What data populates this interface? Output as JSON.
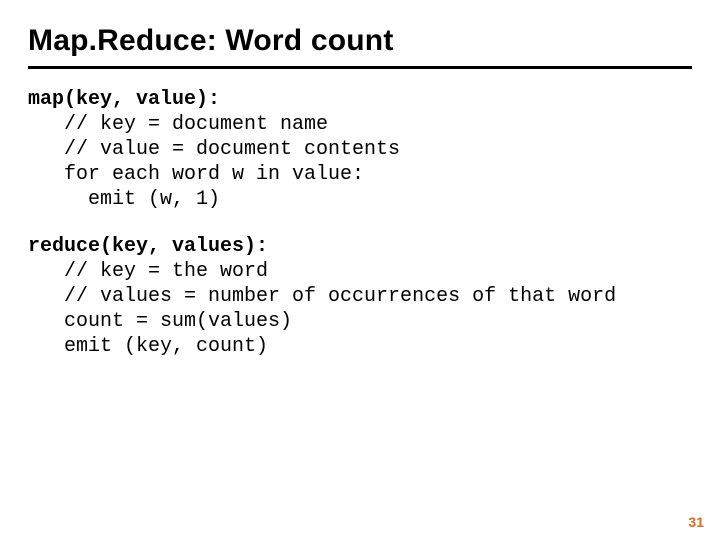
{
  "title": "Map.Reduce: Word count",
  "map": {
    "signature": "map(key, value):",
    "l1": "   // key = document name",
    "l2": "   // value = document contents",
    "l3": "   for each word w in value:",
    "l4": "     emit (w, 1)"
  },
  "reduce": {
    "signature": "reduce(key, values):",
    "l1": "   // key = the word",
    "l2": "   // values = number of occurrences of that word",
    "l3": "   count = sum(values)",
    "l4": "   emit (key, count)"
  },
  "page_number": "31"
}
